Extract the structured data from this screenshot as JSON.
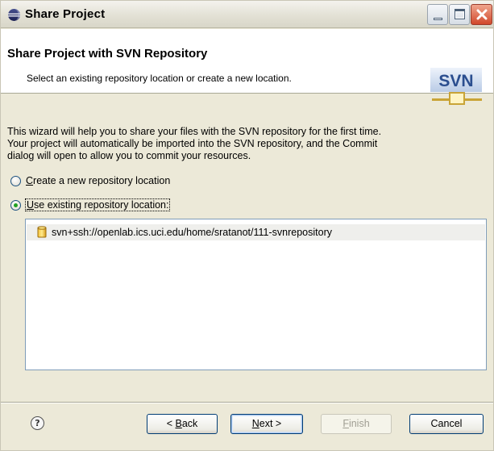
{
  "window": {
    "title": "Share Project",
    "icon": "eclipse-icon"
  },
  "header": {
    "title": "Share Project with SVN Repository",
    "description": "Select an existing repository location or create a new location.",
    "logo_text": "SVN"
  },
  "body": {
    "intro_lines": [
      "This wizard will help you to share your files with the SVN repository for the first time.",
      "Your project will automatically be imported into the SVN repository, and the Commit",
      "dialog will open to allow you to commit your resources."
    ],
    "options": [
      {
        "label_prefix": "",
        "label_mnemonic": "C",
        "label_rest": "reate a new repository location",
        "checked": false
      },
      {
        "label_prefix": "",
        "label_mnemonic": "U",
        "label_rest": "se existing repository location:",
        "checked": true
      }
    ],
    "repositories": [
      {
        "url": "svn+ssh://openlab.ics.uci.edu/home/sratanot/111-svnrepository",
        "icon": "database-icon"
      }
    ]
  },
  "buttons": {
    "help": "?",
    "back_prefix": "< ",
    "back_mnemonic": "B",
    "back_rest": "ack",
    "next_mnemonic": "N",
    "next_rest": "ext >",
    "finish_mnemonic": "F",
    "finish_rest": "inish",
    "cancel": "Cancel"
  }
}
